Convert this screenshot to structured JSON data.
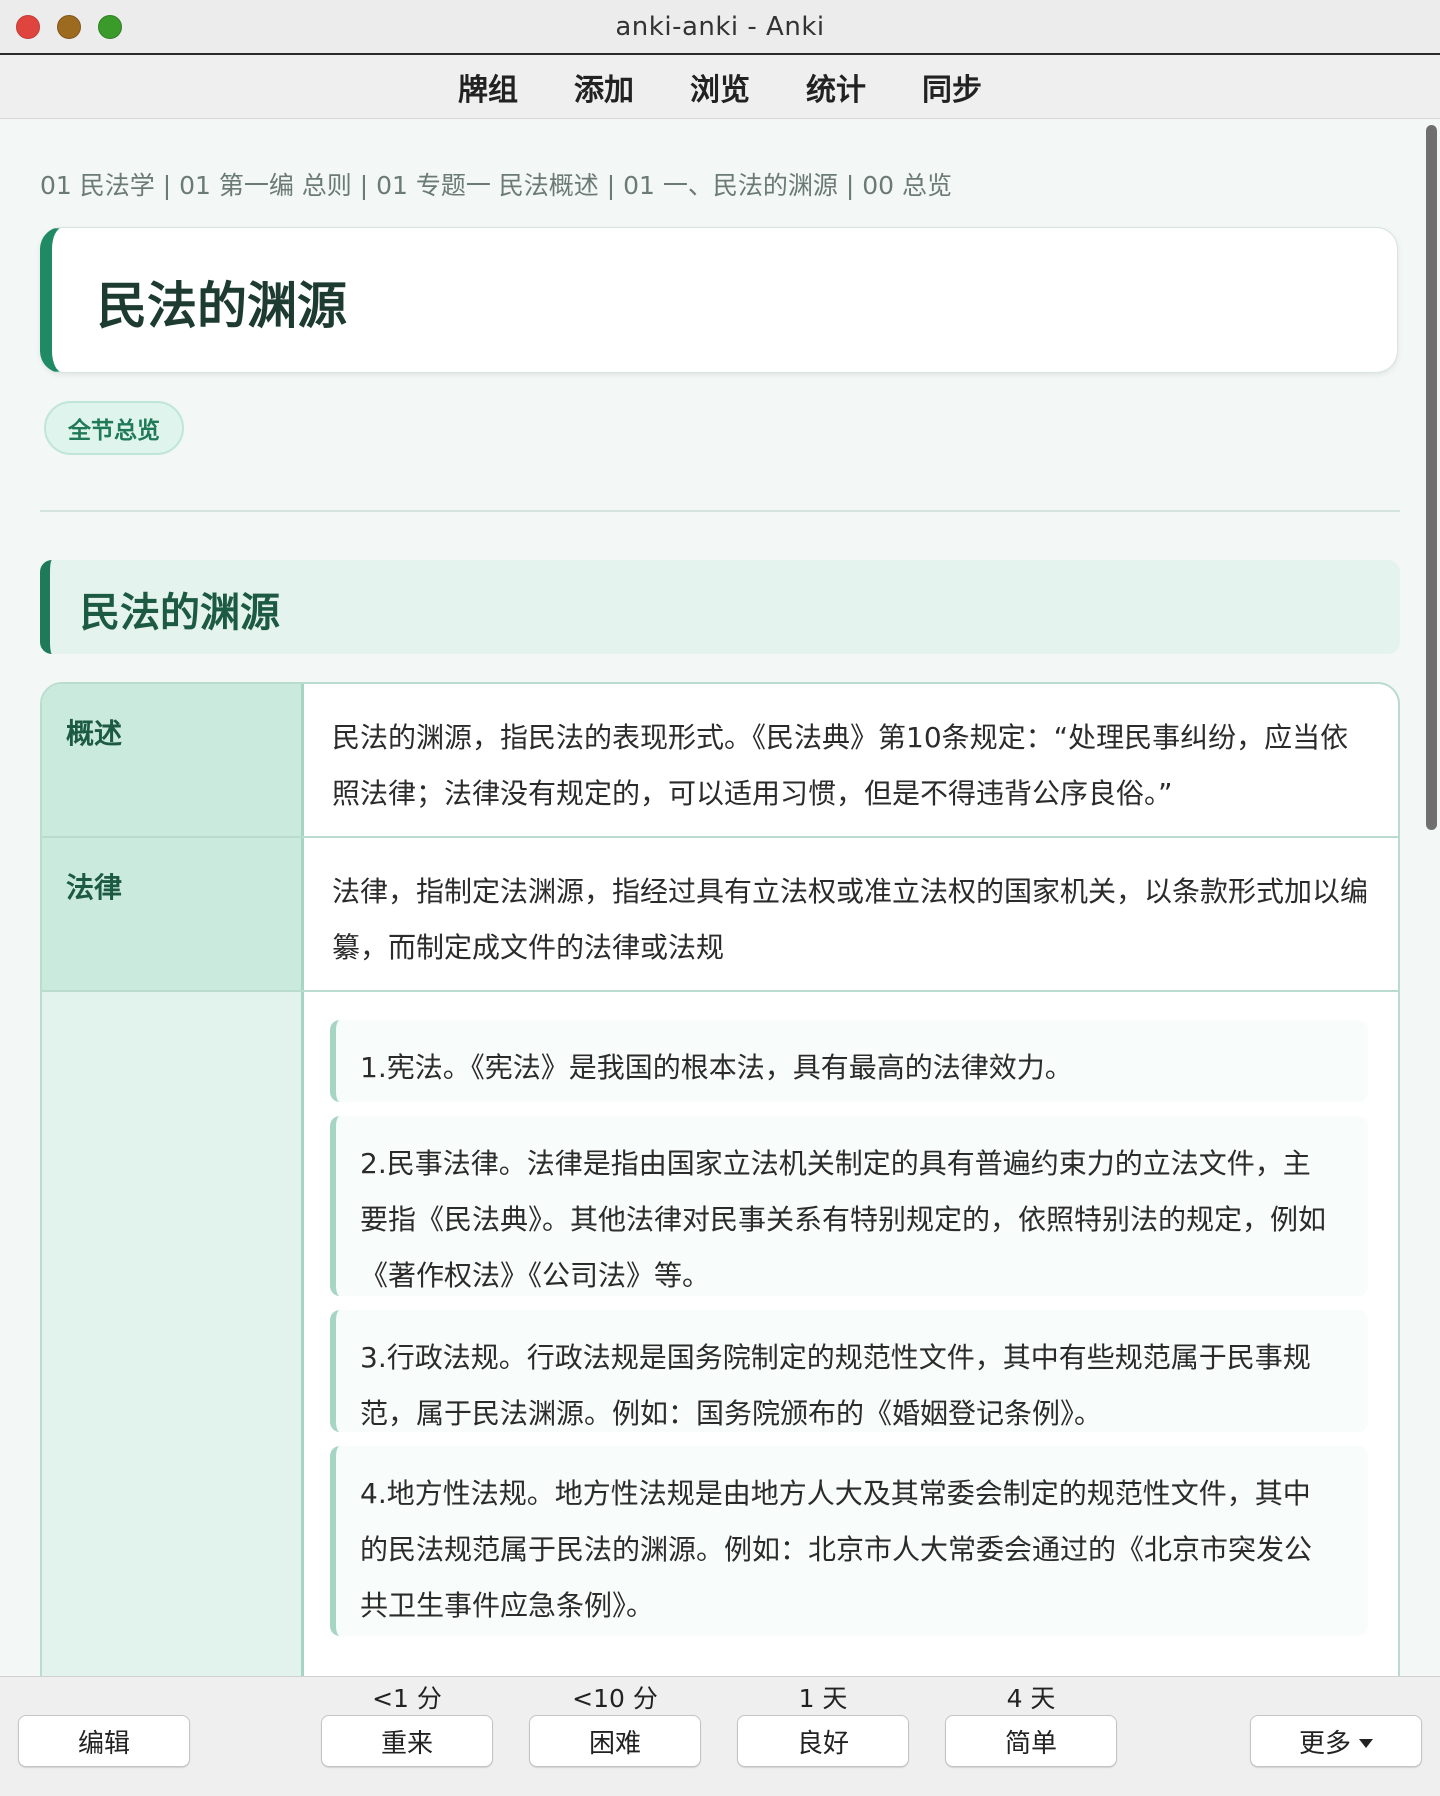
{
  "window": {
    "title": "anki-anki - Anki"
  },
  "toolbar": {
    "items": [
      "牌组",
      "添加",
      "浏览",
      "统计",
      "同步"
    ]
  },
  "card": {
    "breadcrumb": "01 民法学 | 01 第一编 总则 | 01 专题一 民法概述 | 01 一、民法的渊源 | 00 总览",
    "title": "民法的渊源",
    "tag": "全节总览",
    "section_title": "民法的渊源",
    "rows": [
      {
        "key": "概述",
        "value": "民法的渊源，指民法的表现形式。《民法典》第10条规定：“处理民事纠纷，应当依照法律；法律没有规定的，可以适用习惯，但是不得违背公序良俗。”"
      },
      {
        "key": "法律",
        "value": "法律，指制定法渊源，指经过具有立法权或准立法权的国家机关，以条款形式加以编纂，而制定成文件的法律或法规"
      }
    ],
    "items": [
      "1.宪法。《宪法》是我国的根本法，具有最高的法律效力。",
      "2.民事法律。法律是指由国家立法机关制定的具有普遍约束力的立法文件，主要指《民法典》。其他法律对民事关系有特别规定的，依照特别法的规定，例如《著作权法》《公司法》等。",
      "3.行政法规。行政法规是国务院制定的规范性文件，其中有些规范属于民事规范，属于民法渊源。例如：国务院颁布的《婚姻登记条例》。",
      "4.地方性法规。地方性法规是由地方人大及其常委会制定的规范性文件，其中的民法规范属于民法的渊源。例如：北京市人大常委会通过的《北京市突发公共卫生事件应急条例》。"
    ]
  },
  "bottom": {
    "edit": "编辑",
    "more": "更多",
    "answers": [
      {
        "due": "<1 分",
        "label": "重来"
      },
      {
        "due": "<10 分",
        "label": "困难"
      },
      {
        "due": "1 天",
        "label": "良好"
      },
      {
        "due": "4 天",
        "label": "简单"
      }
    ]
  },
  "colors": {
    "accent": "#1f8a63",
    "table_border": "#b9dccf",
    "key_bg": "#c9eadd"
  }
}
